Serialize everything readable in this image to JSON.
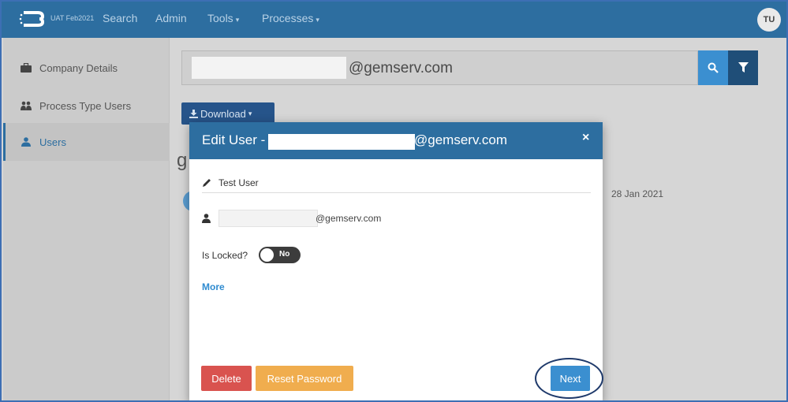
{
  "app": {
    "environment": "UAT Feb2021",
    "avatar_initials": "TU"
  },
  "nav": {
    "search": "Search",
    "admin": "Admin",
    "tools": "Tools",
    "processes": "Processes"
  },
  "sidebar": {
    "items": [
      {
        "label": "Company Details",
        "icon": "briefcase-icon"
      },
      {
        "label": "Process Type Users",
        "icon": "users-icon"
      },
      {
        "label": "Users",
        "icon": "user-icon",
        "active": true
      }
    ]
  },
  "search": {
    "value": "@gemserv.com"
  },
  "toolbar": {
    "download_label": "Download"
  },
  "background": {
    "heading_fragment": "g",
    "date": "28 Jan 2021"
  },
  "modal": {
    "title_prefix": "Edit User - ",
    "title_suffix": "@gemserv.com",
    "close_glyph": "×",
    "name": "Test User",
    "email_suffix": "@gemserv.com",
    "locked_label": "Is Locked?",
    "locked_value": "No",
    "more_label": "More",
    "delete_label": "Delete",
    "reset_label": "Reset Password",
    "next_label": "Next"
  },
  "colors": {
    "brand": "#2d6ea0",
    "primary": "#3b8fd0",
    "danger": "#d9534f",
    "warning": "#f0ad4e",
    "highlight_ring": "#1f3a6b"
  }
}
